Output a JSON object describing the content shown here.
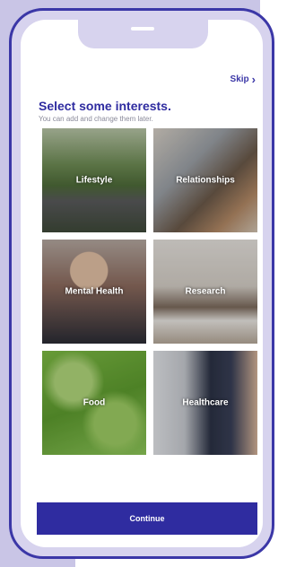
{
  "header": {
    "skip_label": "Skip",
    "title": "Select some interests.",
    "subtitle": "You can add and change them later."
  },
  "interests": [
    {
      "label": "Lifestyle"
    },
    {
      "label": "Relationships"
    },
    {
      "label": "Mental Health"
    },
    {
      "label": "Research"
    },
    {
      "label": "Food"
    },
    {
      "label": "Healthcare"
    }
  ],
  "footer": {
    "continue_label": "Continue"
  },
  "colors": {
    "accent": "#2f2ca0",
    "frame": "#3b37a7",
    "backdrop": "#c9c5e6"
  },
  "icons": {
    "skip": "chevron-right-icon"
  }
}
